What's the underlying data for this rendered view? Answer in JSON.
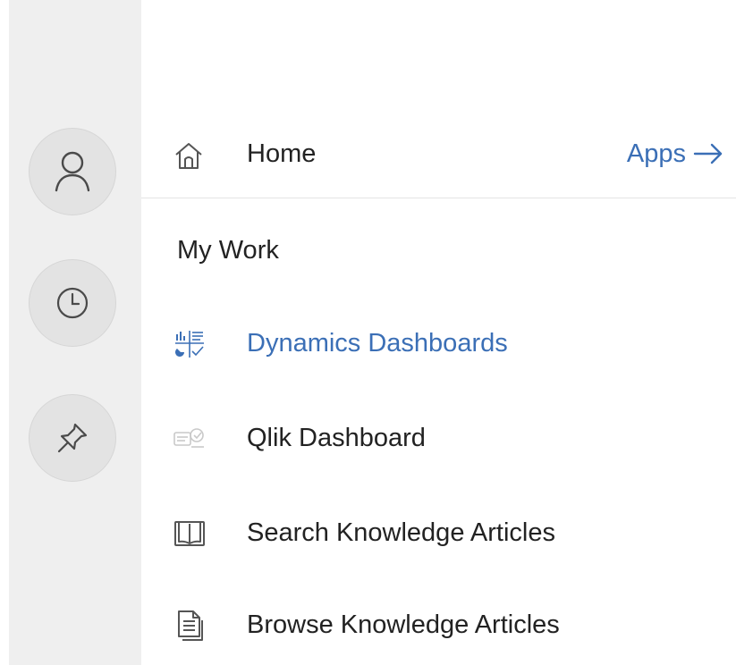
{
  "rail": {
    "buttons": [
      {
        "icon": "person-icon"
      },
      {
        "icon": "clock-icon"
      },
      {
        "icon": "pin-icon"
      }
    ]
  },
  "header": {
    "home_label": "Home",
    "apps_label": "Apps",
    "home_icon": "home-icon",
    "apps_icon": "arrow-right-icon"
  },
  "section": {
    "title": "My Work"
  },
  "nav": {
    "items": [
      {
        "label": "Dynamics Dashboards",
        "icon": "dashboard-icon",
        "active": true
      },
      {
        "label": "Qlik Dashboard",
        "icon": "qlik-icon",
        "active": false
      },
      {
        "label": "Search Knowledge Articles",
        "icon": "book-icon",
        "active": false
      },
      {
        "label": "Browse Knowledge Articles",
        "icon": "document-icon",
        "active": false
      }
    ]
  },
  "colors": {
    "accent": "#3b6fb6",
    "text": "#222222",
    "rail_bg": "#efefef",
    "rail_button_bg": "#e3e3e3"
  }
}
